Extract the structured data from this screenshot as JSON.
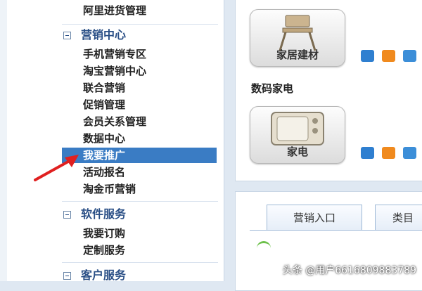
{
  "sidebar": {
    "top_item": "阿里进货管理",
    "sections": [
      {
        "title": "营销中心",
        "items": [
          "手机营销专区",
          "淘宝营销中心",
          "联合营销",
          "促销管理",
          "会员关系管理",
          "数据中心",
          "我要推广",
          "活动报名",
          "淘金币营销"
        ],
        "active_index": 6
      },
      {
        "title": "软件服务",
        "items": [
          "我要订购",
          "定制服务"
        ]
      },
      {
        "title": "客户服务",
        "items": []
      }
    ]
  },
  "main": {
    "tiles": [
      {
        "label": "家居建材",
        "icon": "chair-icon"
      },
      {
        "label": "家电",
        "icon": "tv-icon"
      }
    ],
    "category_title": "数码家电",
    "tabs": [
      "营销入口",
      "类目"
    ]
  },
  "watermark": "头条 @用户6616809883789",
  "colors": {
    "active_bg": "#3a7cc4",
    "section_title": "#2a4f86",
    "arrow": "#e02020"
  }
}
